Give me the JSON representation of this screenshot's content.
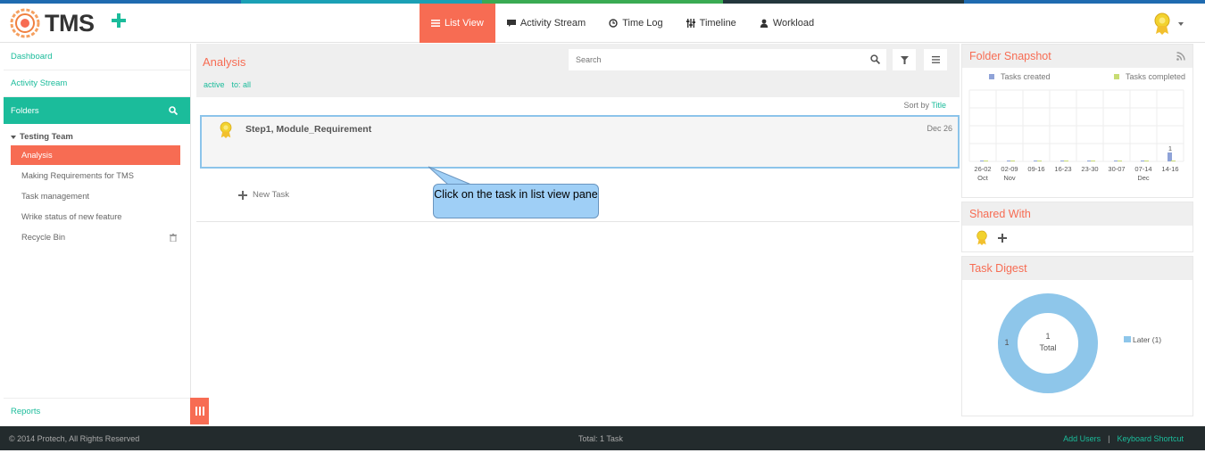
{
  "colors": {
    "accent_orange": "#f76c53",
    "accent_teal": "#1bbc9b",
    "highlight_blue": "#8cc4ea",
    "footer_bg": "#232b2d",
    "top_stripe": [
      "#1f6bb0",
      "#1ba0b5",
      "#3aab53",
      "#23373d",
      "#1f6bb0"
    ]
  },
  "header": {
    "logo_text": "TMS",
    "add_icon": "plus-icon",
    "tabs": [
      {
        "label": "List View",
        "icon": "list-icon",
        "active": true
      },
      {
        "label": "Activity Stream",
        "icon": "comment-icon",
        "active": false
      },
      {
        "label": "Time Log",
        "icon": "clock-icon",
        "active": false
      },
      {
        "label": "Timeline",
        "icon": "sliders-icon",
        "active": false
      },
      {
        "label": "Workload",
        "icon": "user-icon",
        "active": false
      }
    ],
    "user_icon": "avatar-badge-icon"
  },
  "sidebar": {
    "links": [
      {
        "label": "Dashboard"
      },
      {
        "label": "Activity Stream"
      }
    ],
    "folders_label": "Folders",
    "team_label": "Testing Team",
    "folders": [
      {
        "label": "Analysis",
        "active": true
      },
      {
        "label": "Making Requirements for TMS",
        "active": false
      },
      {
        "label": "Task management",
        "active": false
      },
      {
        "label": "Wrike status of new feature",
        "active": false
      },
      {
        "label": "Recycle Bin",
        "active": false
      }
    ],
    "reports_label": "Reports"
  },
  "main": {
    "title": "Analysis",
    "filters": [
      "active",
      "to: all"
    ],
    "search_placeholder": "Search",
    "sort_label": "Sort by",
    "sort_value": "Title",
    "task": {
      "title": "Step1, Module_Requirement",
      "date": "Dec 26"
    },
    "new_task_label": "New Task",
    "callout_text": "Click on the task in list view pane"
  },
  "folder_snapshot": {
    "title": "Folder Snapshot",
    "legend": [
      {
        "label": "Tasks created",
        "color": "#8fa3d8"
      },
      {
        "label": "Tasks completed",
        "color": "#c8dc73"
      }
    ]
  },
  "chart_data": {
    "type": "bar",
    "categories": [
      "26-02 Oct",
      "02-09 Nov",
      "09-16",
      "16-23",
      "23-30",
      "30-07",
      "07-14 Dec",
      "14-16"
    ],
    "tick_top": [
      "26-02",
      "02-09",
      "09-16",
      "16-23",
      "23-30",
      "30-07",
      "07-14",
      "14-16"
    ],
    "tick_bottom": [
      "Oct",
      "Nov",
      "",
      "",
      "",
      "",
      "Dec",
      ""
    ],
    "series": [
      {
        "name": "Tasks created",
        "values": [
          0,
          0,
          0,
          0,
          0,
          0,
          0,
          1
        ]
      },
      {
        "name": "Tasks completed",
        "values": [
          0,
          0,
          0,
          0,
          0,
          0,
          0,
          0
        ]
      }
    ],
    "data_labels": [
      "",
      "",
      "",
      "",
      "",
      "",
      "",
      "1"
    ],
    "ylim": [
      0,
      4
    ],
    "grid": true
  },
  "shared_with": {
    "title": "Shared With",
    "add_icon": "plus-icon"
  },
  "task_digest": {
    "title": "Task Digest",
    "donut": {
      "value": 1,
      "center_value": "1",
      "center_label": "Total",
      "slice_label": "1"
    },
    "legend": [
      {
        "label": "Later (1)",
        "color": "#8ec6ea"
      }
    ]
  },
  "footer": {
    "copyright": "© 2014 Protech, All Rights Reserved",
    "total": "Total: 1 Task",
    "add_users": "Add Users",
    "separator": "|",
    "shortcut": "Keyboard Shortcut"
  }
}
